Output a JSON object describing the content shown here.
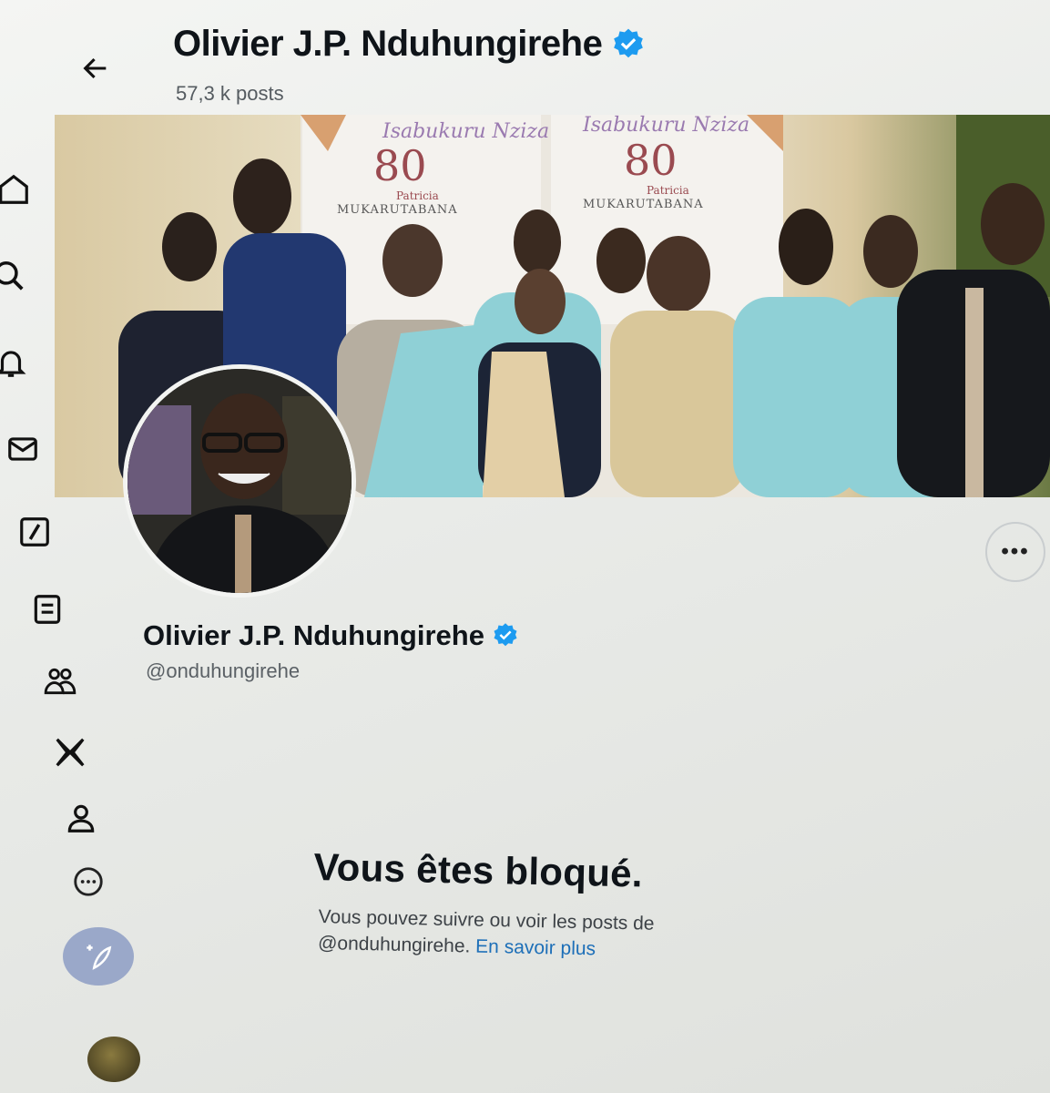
{
  "header": {
    "name": "Olivier J.P. Nduhungirehe",
    "post_count": "57,3 k posts"
  },
  "profile": {
    "name": "Olivier J.P. Nduhungirehe",
    "handle": "@onduhungirehe"
  },
  "banner": {
    "title_left": "Isabukuru Nziza",
    "number_left": "80",
    "subtitle_left": "Patricia",
    "surname_left": "MUKARUTABANA",
    "title_right": "Isabukuru Nziza",
    "number_right": "80",
    "subtitle_right": "Patricia",
    "surname_right": "MUKARUTABANA"
  },
  "blocked": {
    "title": "Vous êtes bloqué.",
    "text_line1": "Vous pouvez suivre ou voir les posts de",
    "text_handle": "@onduhungirehe.",
    "link_label": "En savoir plus"
  },
  "sidebar": {
    "items": [
      "home-icon",
      "search-icon",
      "bell-icon",
      "mail-icon",
      "grok-icon",
      "list-icon",
      "communities-icon",
      "x-logo-icon",
      "profile-icon",
      "more-icon"
    ]
  },
  "colors": {
    "verified": "#1d9bf0",
    "link": "#1d6fb8",
    "compose": "#9aa8c9"
  }
}
